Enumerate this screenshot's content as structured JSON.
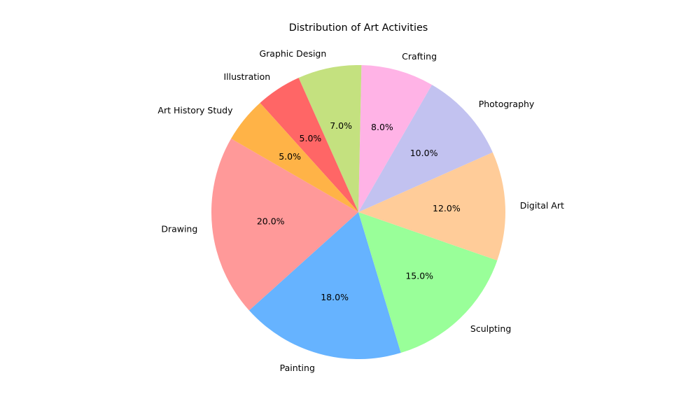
{
  "chart_data": {
    "type": "pie",
    "title": "Distribution of Art Activities",
    "categories": [
      "Drawing",
      "Painting",
      "Sculpting",
      "Digital Art",
      "Photography",
      "Crafting",
      "Graphic Design",
      "Illustration",
      "Art History Study"
    ],
    "values": [
      20.0,
      18.0,
      15.0,
      12.0,
      10.0,
      8.0,
      7.0,
      5.0,
      5.0
    ],
    "value_labels": [
      "20.0%",
      "18.0%",
      "15.0%",
      "12.0%",
      "10.0%",
      "8.0%",
      "7.0%",
      "5.0%",
      "5.0%"
    ],
    "colors": [
      "#ff9999",
      "#66b3ff",
      "#99ff99",
      "#ffcc99",
      "#c2c2f0",
      "#ffb3e6",
      "#c4e17f",
      "#ff6666",
      "#ffb347"
    ],
    "start_angle_deg": 150,
    "direction": "counterclockwise",
    "legend": "none"
  }
}
